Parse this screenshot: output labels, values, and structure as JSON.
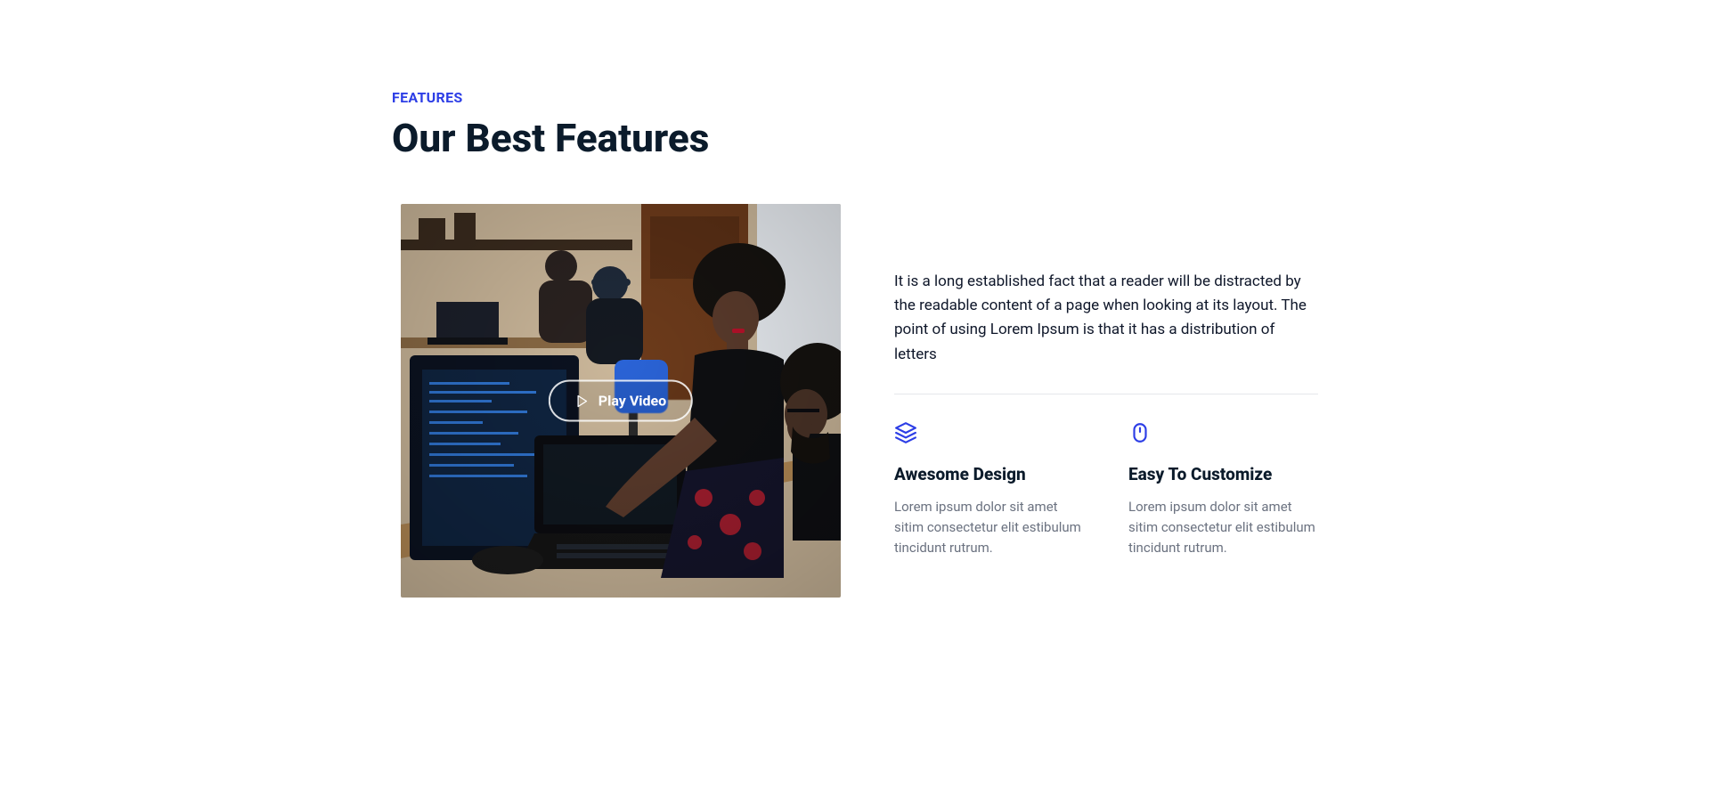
{
  "eyebrow": "FEATURES",
  "title": "Our Best Features",
  "lead": "It is a long established fact that a reader will be distracted by the readable content of a page when looking at its layout. The point of using Lorem Ipsum is that it has a distribution of letters",
  "play_label": "Play Video",
  "cards": [
    {
      "title": "Awesome Design",
      "body": "Lorem ipsum dolor sit amet sitim consectetur elit estibulum tincidunt rutrum."
    },
    {
      "title": "Easy To Customize",
      "body": "Lorem ipsum dolor sit amet sitim consectetur elit estibulum tincidunt rutrum."
    }
  ],
  "colors": {
    "accent": "#2d3ee6",
    "text_dark": "#0b1b2b",
    "text_muted": "#6b7280",
    "divider": "#e5e7eb"
  }
}
